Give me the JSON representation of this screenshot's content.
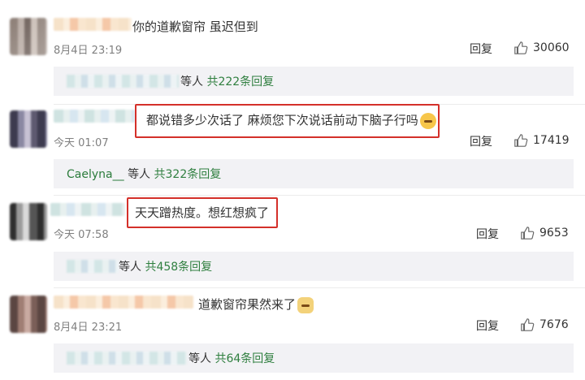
{
  "comments": [
    {
      "text": "你的道歉窗帘  虽迟但到",
      "time": "8月4日 23:19",
      "reply_label": "回复",
      "likes": "30060",
      "reply_summary": {
        "user": "",
        "suffix": "等人",
        "count": "共222条回复"
      }
    },
    {
      "text": "都说错多少次话了 麻烦您下次说话前动下脑子行吗",
      "time": "今天 01:07",
      "reply_label": "回复",
      "likes": "17419",
      "reply_summary": {
        "user": "Caelyna__",
        "suffix": "等人",
        "count": "共322条回复"
      }
    },
    {
      "text": "天天蹭热度。想红想疯了",
      "time": "今天 07:58",
      "reply_label": "回复",
      "likes": "9653",
      "reply_summary": {
        "user": "",
        "suffix": "等人",
        "count": "共458条回复"
      }
    },
    {
      "text": "道歉窗帘果然来了",
      "time": "8月4日 23:21",
      "reply_label": "回复",
      "likes": "7676",
      "reply_summary": {
        "user": "",
        "suffix": "等人",
        "count": "共64条回复"
      }
    }
  ],
  "colors": {
    "highlight": "#d4302a",
    "reply_link": "#2f7f3f",
    "muted": "#808080"
  },
  "icons": {
    "like": "thumbs-up-icon",
    "emoji_surprised": "surprised-face-icon",
    "emoji_dog": "dog-face-icon"
  }
}
